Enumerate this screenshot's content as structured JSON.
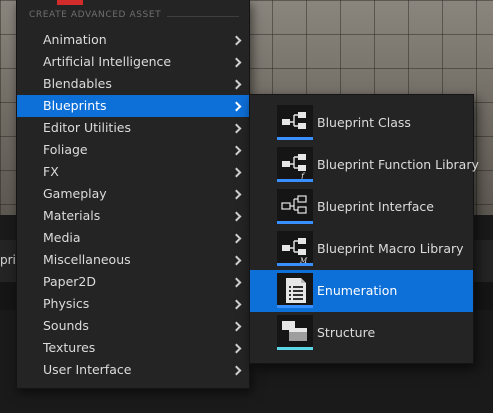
{
  "toolbar_fragment": "pri",
  "menu": {
    "section_header": "CREATE ADVANCED ASSET",
    "items": [
      {
        "label": "Animation"
      },
      {
        "label": "Artificial Intelligence"
      },
      {
        "label": "Blendables"
      },
      {
        "label": "Blueprints",
        "selected": true
      },
      {
        "label": "Editor Utilities"
      },
      {
        "label": "Foliage"
      },
      {
        "label": "FX"
      },
      {
        "label": "Gameplay"
      },
      {
        "label": "Materials"
      },
      {
        "label": "Media"
      },
      {
        "label": "Miscellaneous"
      },
      {
        "label": "Paper2D"
      },
      {
        "label": "Physics"
      },
      {
        "label": "Sounds"
      },
      {
        "label": "Textures"
      },
      {
        "label": "User Interface"
      }
    ]
  },
  "submenu": {
    "items": [
      {
        "label": "Blueprint Class",
        "icon": "blueprint-class-icon",
        "accent": "#3a8fff"
      },
      {
        "label": "Blueprint Function Library",
        "icon": "blueprint-function-library-icon",
        "accent": "#3a8fff"
      },
      {
        "label": "Blueprint Interface",
        "icon": "blueprint-interface-icon",
        "accent": "#3a8fff"
      },
      {
        "label": "Blueprint Macro Library",
        "icon": "blueprint-macro-library-icon",
        "accent": "#3a8fff"
      },
      {
        "label": "Enumeration",
        "icon": "enumeration-icon",
        "accent": "#3a8fff",
        "selected": true
      },
      {
        "label": "Structure",
        "icon": "structure-icon",
        "accent": "#5bd6e6"
      }
    ]
  },
  "colors": {
    "highlight": "#0d6fd8",
    "menu_background": "#242424",
    "icon_accent_blue": "#3a8fff",
    "icon_accent_cyan": "#5bd6e6"
  }
}
